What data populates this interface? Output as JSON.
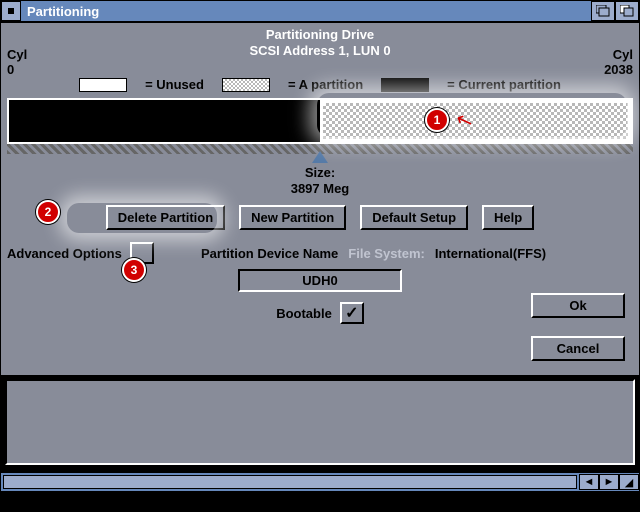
{
  "window": {
    "title": "Partitioning"
  },
  "header": {
    "title": "Partitioning Drive",
    "subtitle": "SCSI Address 1, LUN 0",
    "cyl_label": "Cyl",
    "cyl_start": "0",
    "cyl_end": "2038"
  },
  "legend": {
    "unused": "= Unused",
    "a_partition": "= A partition",
    "current": "= Current partition"
  },
  "size": {
    "label": "Size:",
    "value": "3897 Meg"
  },
  "buttons": {
    "delete": "Delete Partition",
    "new": "New Partition",
    "default": "Default Setup",
    "help": "Help",
    "ok": "Ok",
    "cancel": "Cancel"
  },
  "advanced": {
    "label": "Advanced Options",
    "checked": false
  },
  "pdn": {
    "label": "Partition Device Name",
    "fs_label": "File System:",
    "fs_value": "International(FFS)",
    "value": "UDH0"
  },
  "bootable": {
    "label": "Bootable",
    "checked": true
  },
  "callouts": {
    "c1": "1",
    "c2": "2",
    "c3": "3"
  }
}
